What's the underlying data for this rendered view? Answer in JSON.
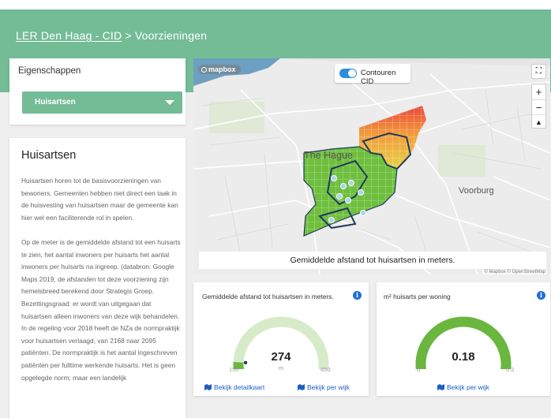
{
  "header": {
    "breadcrumb_link": "LER Den Haag - CID",
    "breadcrumb_separator": ">",
    "breadcrumb_current": "Voorzieningen"
  },
  "properties": {
    "title": "Eigenschappen",
    "selected_option": "Huisartsen"
  },
  "info": {
    "title": "Huisartsen",
    "paragraphs": [
      "Huisartsen horen tot de basisvoorzieningen van bewoners. Gemeenten hebben niet direct een taak in de huisvesting van huisartsen maar de gemeente kan hier wel een faciliterende rol in spelen.",
      "Op de meter is de gemiddelde afstand tot een huisarts te zien, het aantal inwoners per huisarts het aantal inwoners per huisarts na ingreep. (databron: Google Maps 2019, de afstanden tot deze voorziening zijn hemelsbreed berekend door Strategis Groep. Bezettingsgraad: er wordt van uitgegaan dat huisartsen alleen inwoners van deze wijk behandelen. In de regeling voor 2018 heeft de NZa de normpraktijk voor huisartsen verlaagd, van 2168 naar 2095 patiënten. De normpraktijk is het aantal ingeschreven patiënten per fulltime werkende huisarts. Het is geen opgelegde norm; maar een landelijk"
    ]
  },
  "map": {
    "logo": "mapbox",
    "toggle_label": "Contouren CID",
    "toggle_on": true,
    "zoom_in": "+",
    "zoom_out": "−",
    "compass": "▲",
    "fullscreen": "⛶",
    "place_hague": "The Hague",
    "place_voorburg": "Voorburg",
    "caption": "Gemiddelde afstand tot huisartsen in meters.",
    "attribution": "© Mapbox © OpenStreetMap"
  },
  "gauges": [
    {
      "title": "Gemiddelde afstand tot huisartsen in meters.",
      "value": "274",
      "unit": "m",
      "min": "150",
      "max": "850",
      "fraction": 0.177,
      "link_a": "Bekijk detailkaart",
      "link_b": "Bekijk per wijk"
    },
    {
      "title": "m² huisarts per woning",
      "value": "0.18",
      "unit": "",
      "min": "0",
      "max": "0.2",
      "fraction": 0.9,
      "link_a": "Bekijk per wijk"
    }
  ],
  "colors": {
    "accent": "#73bc96",
    "gauge_fill": "#6ab63e",
    "gauge_track": "#d7ebc8",
    "link": "#1e5fc2",
    "info_icon": "#1e6fd9"
  }
}
